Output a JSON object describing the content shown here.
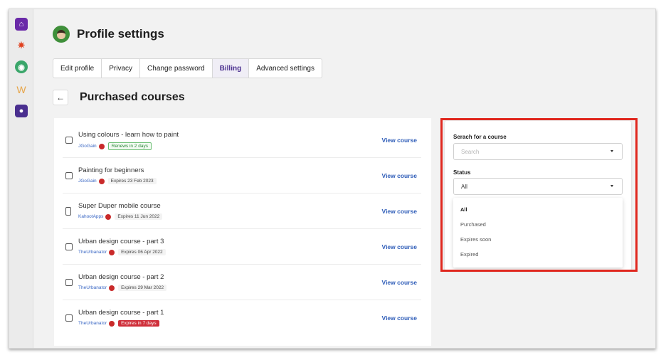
{
  "header": {
    "title": "Profile settings"
  },
  "tabs": [
    {
      "label": "Edit profile",
      "active": false
    },
    {
      "label": "Privacy",
      "active": false
    },
    {
      "label": "Change password",
      "active": false
    },
    {
      "label": "Billing",
      "active": true
    },
    {
      "label": "Advanced settings",
      "active": false
    }
  ],
  "section": {
    "back_icon": "←",
    "title": "Purchased courses"
  },
  "courses": [
    {
      "name": "Using colours - learn how to paint",
      "author": "JGoGain",
      "status": "Renews in 2 days",
      "status_style": "green",
      "icon": "lock-course-icon",
      "link": "View course"
    },
    {
      "name": "Painting for beginners",
      "author": "JGoGain",
      "status": "Expires 23 Feb 2023",
      "status_style": "gray",
      "icon": "lock-course-icon",
      "link": "View course"
    },
    {
      "name": "Super Duper mobile course",
      "author": "KahootApps",
      "status": "Expires 11 Jun 2022",
      "status_style": "gray",
      "icon": "mobile-course-icon",
      "link": "View course"
    },
    {
      "name": "Urban design course - part 3",
      "author": "TheUrbanator",
      "status": "Expires 06 Apr 2022",
      "status_style": "gray",
      "icon": "lock-course-icon",
      "link": "View course"
    },
    {
      "name": "Urban design course - part 2",
      "author": "TheUrbanator",
      "status": "Expires 29 Mar 2022",
      "status_style": "gray",
      "icon": "lock-course-icon",
      "link": "View course"
    },
    {
      "name": "Urban design course - part 1",
      "author": "TheUrbanator",
      "status": "Expires in 7 days",
      "status_style": "red",
      "icon": "lock-course-icon",
      "link": "View course"
    }
  ],
  "filters": {
    "search_label": "Serach for a course",
    "search_placeholder": "Search",
    "status_label": "Status",
    "status_value": "All",
    "status_options": [
      "All",
      "Purchased",
      "Expires soon",
      "Expired"
    ]
  },
  "colors": {
    "accent": "#4a2f8f",
    "link": "#2f5db8",
    "highlight": "#e0271e",
    "danger": "#cf2f3a"
  }
}
